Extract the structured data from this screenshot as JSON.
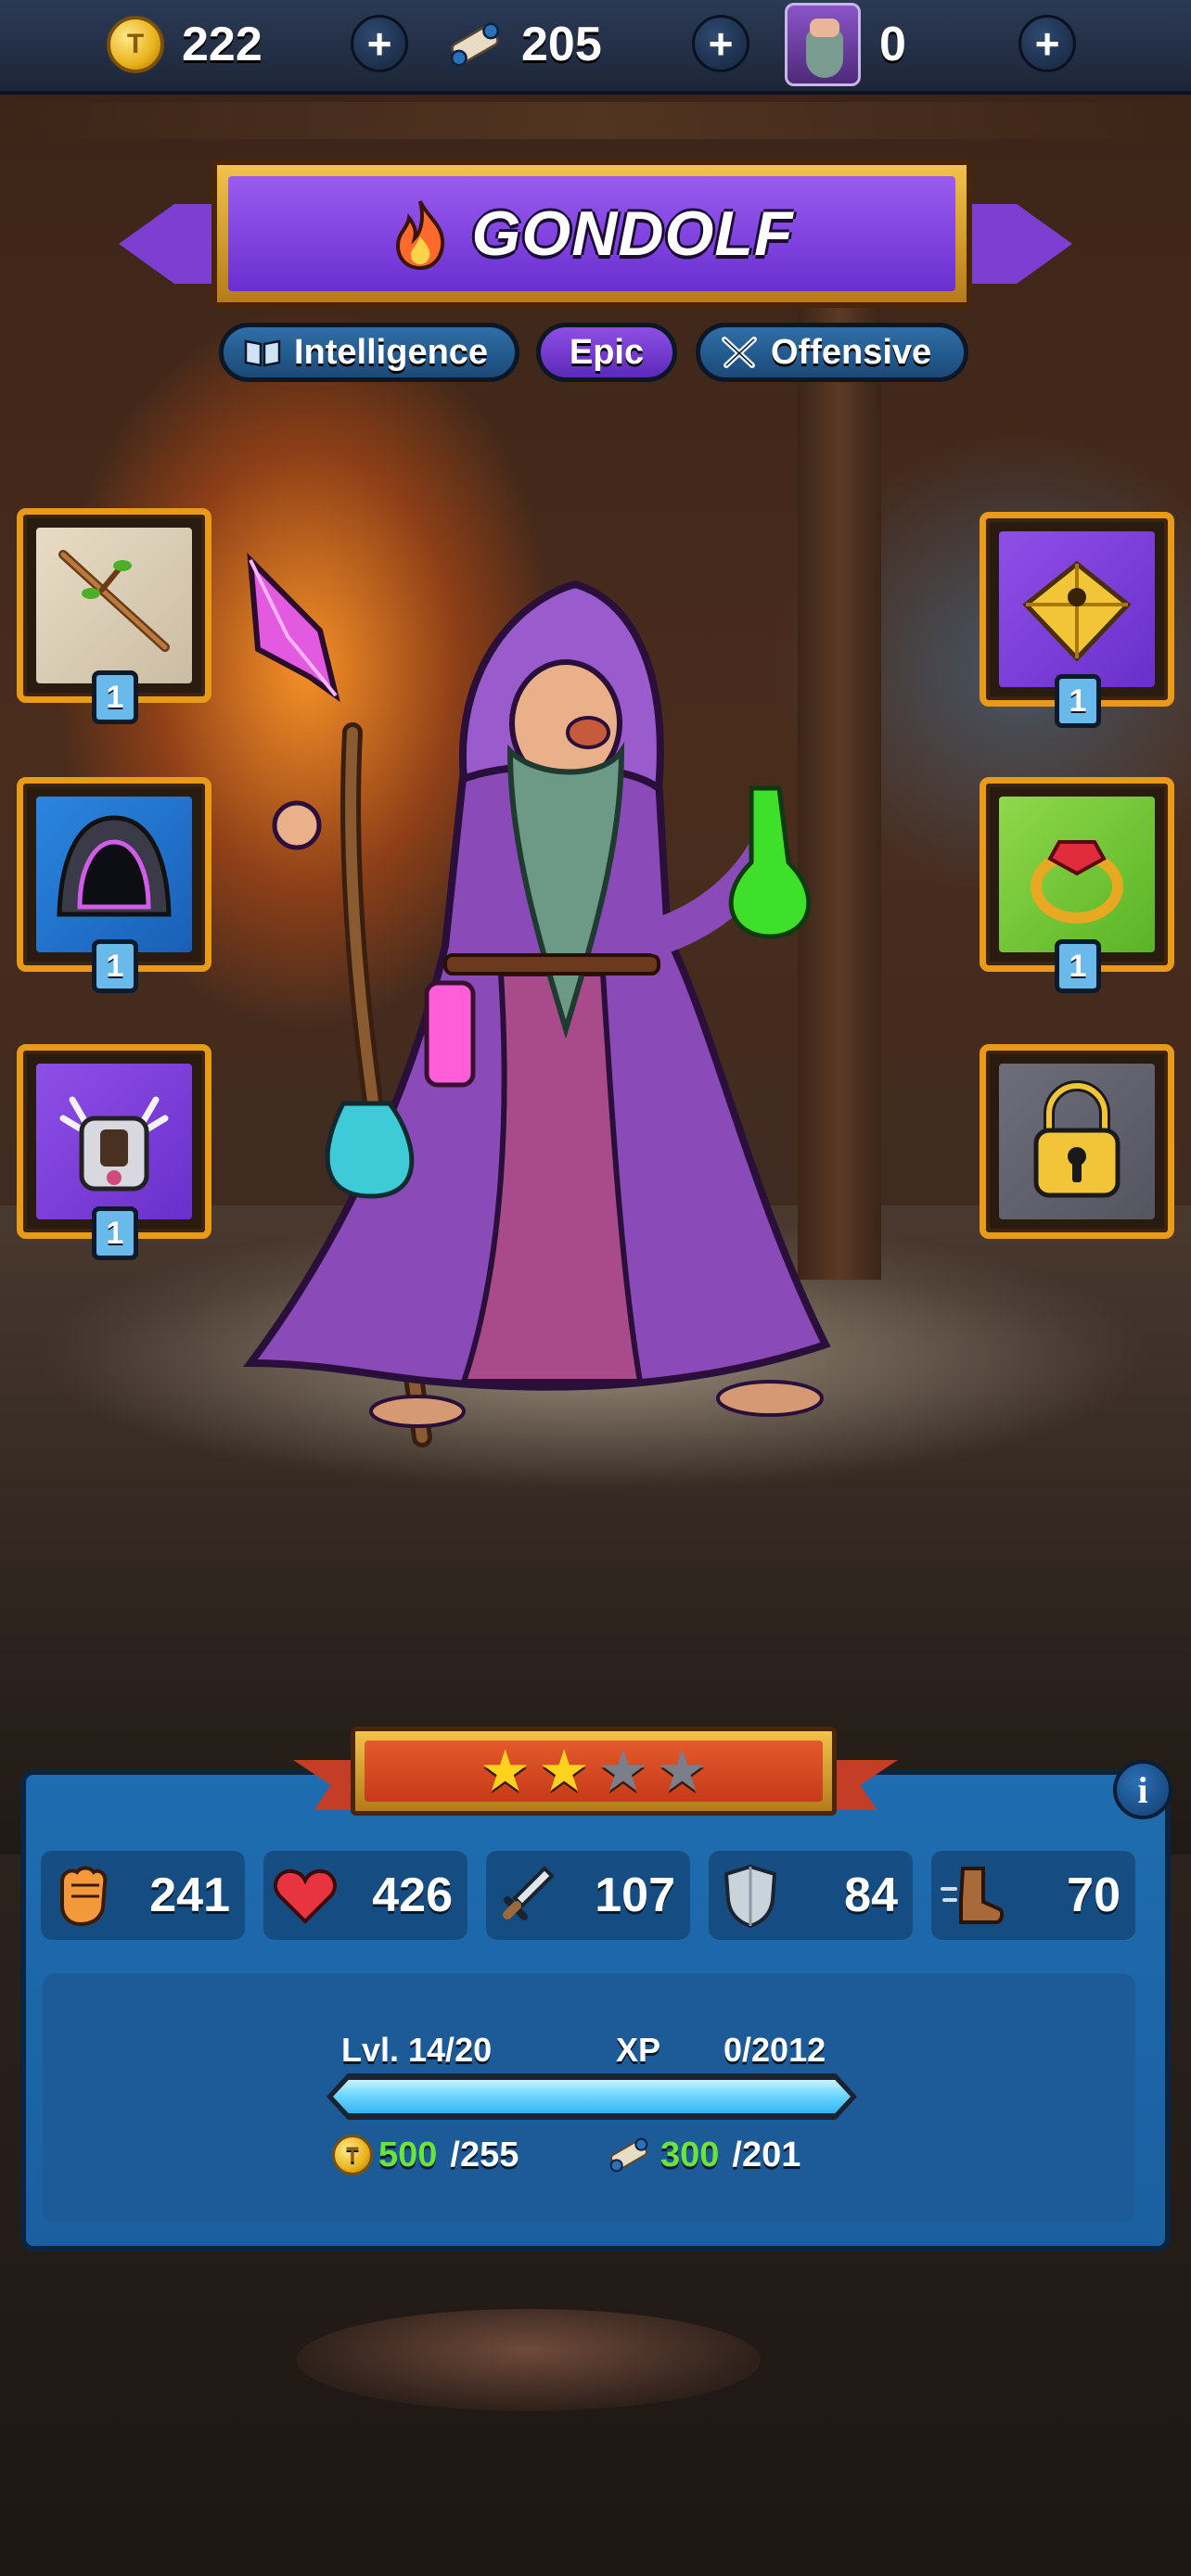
{
  "top_bar": {
    "coins": {
      "value": "222",
      "icon": "gold-coin-icon"
    },
    "scrolls": {
      "value": "205",
      "icon": "scroll-icon"
    },
    "hero_shards": {
      "value": "0",
      "icon": "wizard-portrait-icon"
    },
    "plus_label": "+"
  },
  "hero": {
    "name": "GONDOLF",
    "element_icon": "fire-icon",
    "tags": [
      {
        "label": "Intelligence",
        "icon": "book-icon"
      },
      {
        "label": "Epic"
      },
      {
        "label": "Offensive",
        "icon": "crossed-swords-icon"
      }
    ],
    "stars": {
      "earned": 2,
      "total": 4
    },
    "stars_glyphs": [
      "★",
      "★",
      "★",
      "★"
    ]
  },
  "equipment": {
    "left": [
      {
        "item": "branch-staff-icon",
        "level": "1",
        "rarity": "common"
      },
      {
        "item": "dark-hood-icon",
        "level": "1",
        "rarity": "rare"
      },
      {
        "item": "spiked-armor-icon",
        "level": "1",
        "rarity": "epic"
      }
    ],
    "right": [
      {
        "item": "golden-pyramid-icon",
        "level": "1",
        "rarity": "epic"
      },
      {
        "item": "ruby-ring-icon",
        "level": "1",
        "rarity": "uncommon"
      },
      {
        "item": "padlock-icon",
        "level": "",
        "rarity": "locked"
      }
    ]
  },
  "stats": {
    "power": {
      "icon": "fist-icon",
      "value": "241"
    },
    "health": {
      "icon": "heart-icon",
      "value": "426"
    },
    "attack": {
      "icon": "sword-icon",
      "value": "107"
    },
    "defense": {
      "icon": "shield-icon",
      "value": "84"
    },
    "speed": {
      "icon": "boot-icon",
      "value": "70"
    }
  },
  "level": {
    "label": "Lvl. 14/20",
    "xp_label": "XP",
    "xp_value": "0/2012",
    "xp_fill": 1.0,
    "cost_coins": {
      "have": "500",
      "need": "/255"
    },
    "cost_scrolls": {
      "have": "300",
      "need": "/201"
    }
  },
  "info_label": "i",
  "colors": {
    "accent_purple": "#7d3fd1",
    "frame_gold": "#e99a16",
    "panel_blue": "#1e6db0",
    "star_gold": "#ffd21e",
    "resource_green": "#69e43c"
  }
}
